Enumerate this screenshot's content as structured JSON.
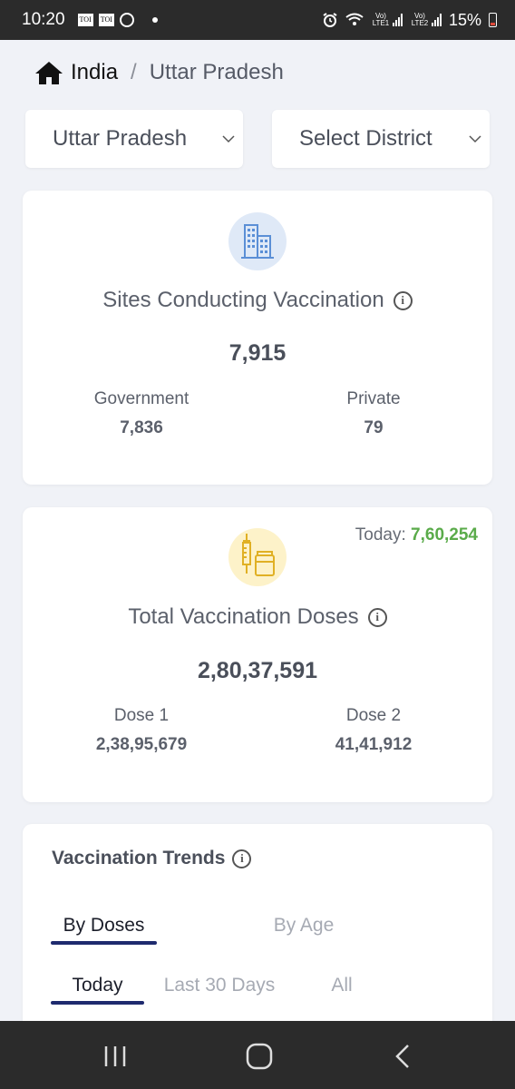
{
  "status_bar": {
    "time": "10:20",
    "toi_label": "TOI",
    "signal_label_1": "Vo) LTE1",
    "signal_label_2": "Vo) LTE2",
    "battery": "15%"
  },
  "breadcrumb": {
    "home": "India",
    "separator": "/",
    "current": "Uttar Pradesh"
  },
  "filters": {
    "state": "Uttar Pradesh",
    "district": "Select District"
  },
  "sites_card": {
    "title": "Sites Conducting Vaccination",
    "total": "7,915",
    "government_label": "Government",
    "government_value": "7,836",
    "private_label": "Private",
    "private_value": "79"
  },
  "doses_card": {
    "today_label": "Today:",
    "today_value": "7,60,254",
    "title": "Total Vaccination Doses",
    "total": "2,80,37,591",
    "dose1_label": "Dose 1",
    "dose1_value": "2,38,95,679",
    "dose2_label": "Dose 2",
    "dose2_value": "41,41,912"
  },
  "trends_card": {
    "title": "Vaccination Trends",
    "tabs": [
      "By Doses",
      "By Age"
    ],
    "active_tab": "By Doses",
    "range_tabs": [
      "Today",
      "Last 30 Days",
      "All"
    ],
    "active_range": "Today"
  },
  "colors": {
    "accent": "#1e2a6e",
    "positive": "#5aab4a",
    "background": "#f0f2f7"
  }
}
